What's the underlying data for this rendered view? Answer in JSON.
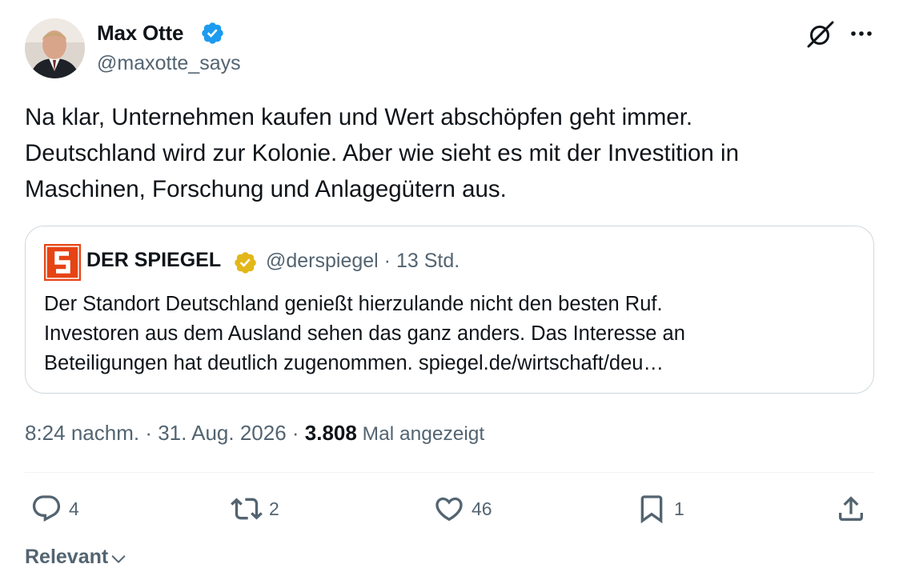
{
  "author": {
    "name": "Max Otte",
    "handle": "@maxotte_says"
  },
  "tweet": {
    "lines": [
      "Na klar, Unternehmen kaufen und Wert abschöpfen geht immer.",
      "Deutschland wird zur Kolonie. Aber wie sieht es mit der Investition in",
      "Maschinen, Forschung und Anlagegütern aus."
    ]
  },
  "quote": {
    "logo_letter": "S",
    "name": "DER SPIEGEL",
    "meta": "@derspiegel · 13 Std.",
    "lines": [
      "Der Standort Deutschland genießt hierzulande nicht den besten Ruf.",
      "Investoren aus dem Ausland sehen das ganz anders. Das Interesse an",
      "Beteiligungen hat deutlich zugenommen. spiegel.de/wirtschaft/deu…"
    ],
    "logo_color": "#e64415"
  },
  "meta": {
    "time_date": "8:24 nachm. · 31. Aug. 2026 · ",
    "views": "3.808",
    "views_label": " Mal angezeigt"
  },
  "actions": {
    "replies": "4",
    "retweets": "2",
    "likes": "46",
    "bookmarks": "1"
  },
  "sort": {
    "label": "Relevant"
  },
  "colors": {
    "verified_blue": "#1d9bf0",
    "verified_gold": "#e2b719",
    "secondary_text": "#536471"
  },
  "icons": [
    "grok-icon",
    "more-icon",
    "reply-icon",
    "retweet-icon",
    "like-icon",
    "bookmark-icon",
    "share-icon",
    "chevron-down-icon",
    "verified-badge-icon"
  ]
}
